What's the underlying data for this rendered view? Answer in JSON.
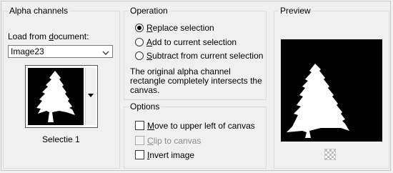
{
  "alpha_channels": {
    "title": "Alpha channels",
    "load_label_pre": "Load from ",
    "load_label_u": "d",
    "load_label_post": "ocument:",
    "document_value": "Image23",
    "thumbnail_caption": "Selectie 1"
  },
  "operation": {
    "title": "Operation",
    "options": [
      {
        "u": "R",
        "rest": "eplace selection",
        "selected": true
      },
      {
        "u": "A",
        "rest": "dd to current selection",
        "selected": false
      },
      {
        "u": "S",
        "rest": "ubtract from current selection",
        "selected": false
      }
    ],
    "description": "The original alpha channel rectangle completely intersects the canvas."
  },
  "options": {
    "title": "Options",
    "items": [
      {
        "u": "M",
        "rest": "ove to upper left of canvas",
        "checked": false,
        "disabled": false
      },
      {
        "u": "C",
        "rest": "lip to canvas",
        "checked": false,
        "disabled": true
      },
      {
        "u": "I",
        "rest": "nvert image",
        "checked": false,
        "disabled": false
      }
    ]
  },
  "preview": {
    "title": "Preview"
  },
  "icons": {
    "dropdown": "chevron-down-icon",
    "thumb_dropdown": "triangle-down-icon",
    "preview_toggle": "checkerboard-icon"
  }
}
